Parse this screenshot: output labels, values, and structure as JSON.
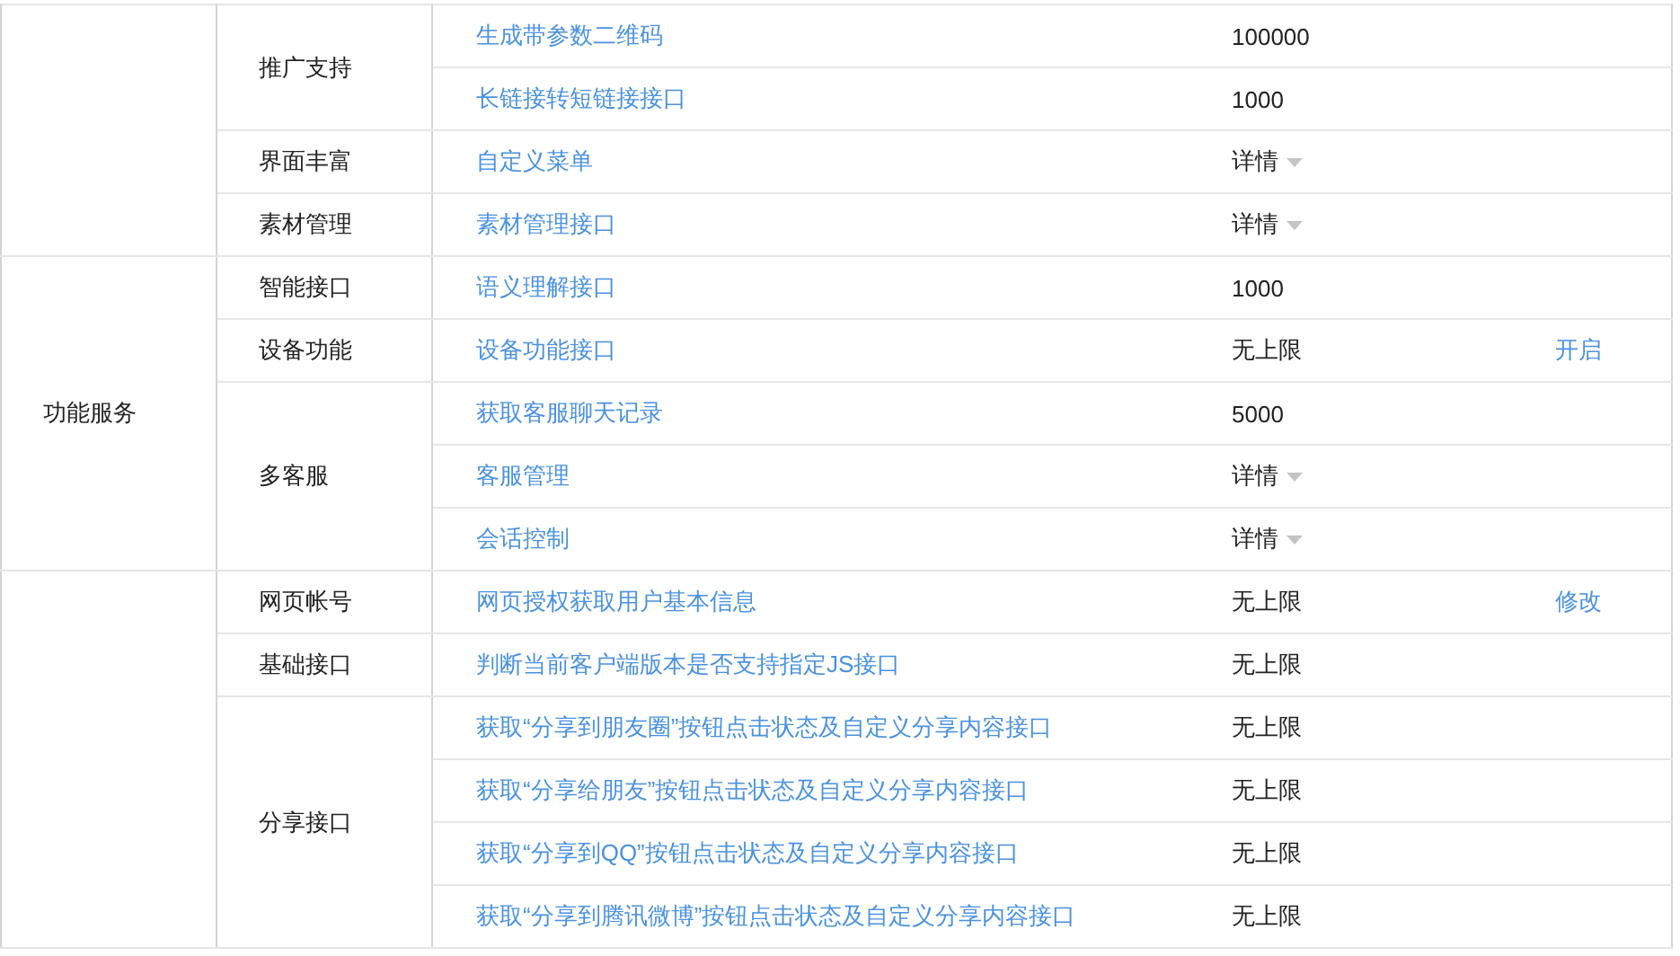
{
  "groups": [
    {
      "subgroups": [
        {
          "label": "推广支持",
          "items": [
            {
              "name": "生成带参数二维码",
              "quota": "100000",
              "kind": "text"
            },
            {
              "name": "长链接转短链接接口",
              "quota": "1000",
              "kind": "text"
            }
          ]
        },
        {
          "label": "界面丰富",
          "items": [
            {
              "name": "自定义菜单",
              "quota": "详情",
              "kind": "dropdown"
            }
          ]
        },
        {
          "label": "素材管理",
          "items": [
            {
              "name": "素材管理接口",
              "quota": "详情",
              "kind": "dropdown"
            }
          ]
        }
      ]
    },
    {
      "label": "功能服务",
      "subgroups": [
        {
          "label": "智能接口",
          "items": [
            {
              "name": "语义理解接口",
              "quota": "1000",
              "kind": "text"
            }
          ]
        },
        {
          "label": "设备功能",
          "items": [
            {
              "name": "设备功能接口",
              "quota": "无上限",
              "kind": "text",
              "action": "开启"
            }
          ]
        },
        {
          "label": "多客服",
          "items": [
            {
              "name": "获取客服聊天记录",
              "quota": "5000",
              "kind": "text"
            },
            {
              "name": "客服管理",
              "quota": "详情",
              "kind": "dropdown"
            },
            {
              "name": "会话控制",
              "quota": "详情",
              "kind": "dropdown"
            }
          ]
        }
      ]
    },
    {
      "subgroups": [
        {
          "label": "网页帐号",
          "items": [
            {
              "name": "网页授权获取用户基本信息",
              "quota": "无上限",
              "kind": "text",
              "action": "修改"
            }
          ]
        },
        {
          "label": "基础接口",
          "items": [
            {
              "name": "判断当前客户端版本是否支持指定JS接口",
              "quota": "无上限",
              "kind": "text"
            }
          ]
        },
        {
          "label": "分享接口",
          "items": [
            {
              "name": "获取“分享到朋友圈”按钮点击状态及自定义分享内容接口",
              "quota": "无上限",
              "kind": "text"
            },
            {
              "name": "获取“分享给朋友”按钮点击状态及自定义分享内容接口",
              "quota": "无上限",
              "kind": "text"
            },
            {
              "name": "获取“分享到QQ”按钮点击状态及自定义分享内容接口",
              "quota": "无上限",
              "kind": "text"
            },
            {
              "name": "获取“分享到腾讯微博”按钮点击状态及自定义分享内容接口",
              "quota": "无上限",
              "kind": "text"
            }
          ]
        }
      ]
    }
  ]
}
